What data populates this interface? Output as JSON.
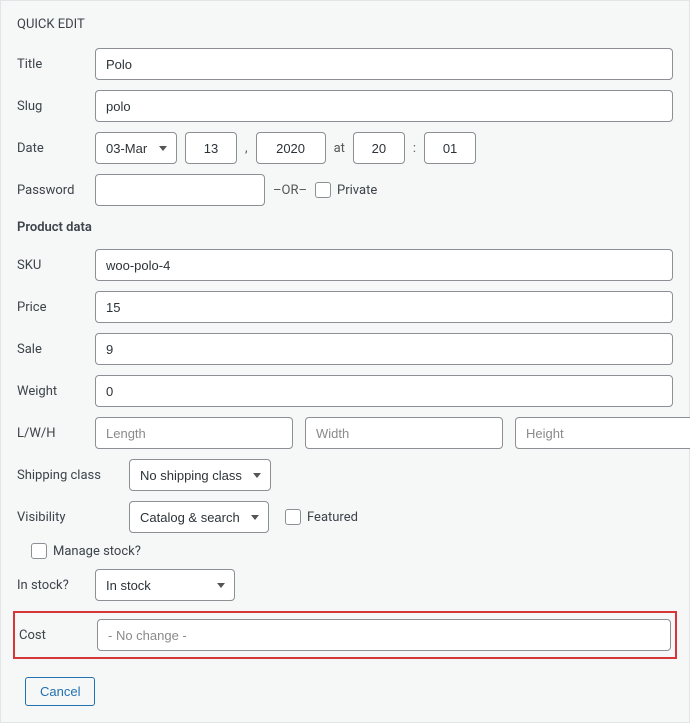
{
  "panelTitle": "QUICK EDIT",
  "labels": {
    "title": "Title",
    "slug": "Slug",
    "date": "Date",
    "at": "at",
    "comma": ",",
    "colon": ":",
    "password": "Password",
    "or": "–OR–",
    "private": "Private",
    "productData": "Product data",
    "sku": "SKU",
    "price": "Price",
    "sale": "Sale",
    "weight": "Weight",
    "lwh": "L/W/H",
    "shippingClass": "Shipping class",
    "visibility": "Visibility",
    "featured": "Featured",
    "manageStock": "Manage stock?",
    "inStock": "In stock?",
    "cost": "Cost"
  },
  "values": {
    "title": "Polo",
    "slug": "polo",
    "month": "03-Mar",
    "day": "13",
    "year": "2020",
    "hour": "20",
    "minute": "01",
    "password": "",
    "sku": "woo-polo-4",
    "price": "15",
    "sale": "9",
    "weight": "0",
    "length": "",
    "width": "",
    "height": "",
    "shippingClass": "No shipping class",
    "visibility": "Catalog & search",
    "inStock": "In stock",
    "cost": ""
  },
  "placeholders": {
    "length": "Length",
    "width": "Width",
    "height": "Height",
    "cost": "- No change -"
  },
  "buttons": {
    "cancel": "Cancel"
  }
}
